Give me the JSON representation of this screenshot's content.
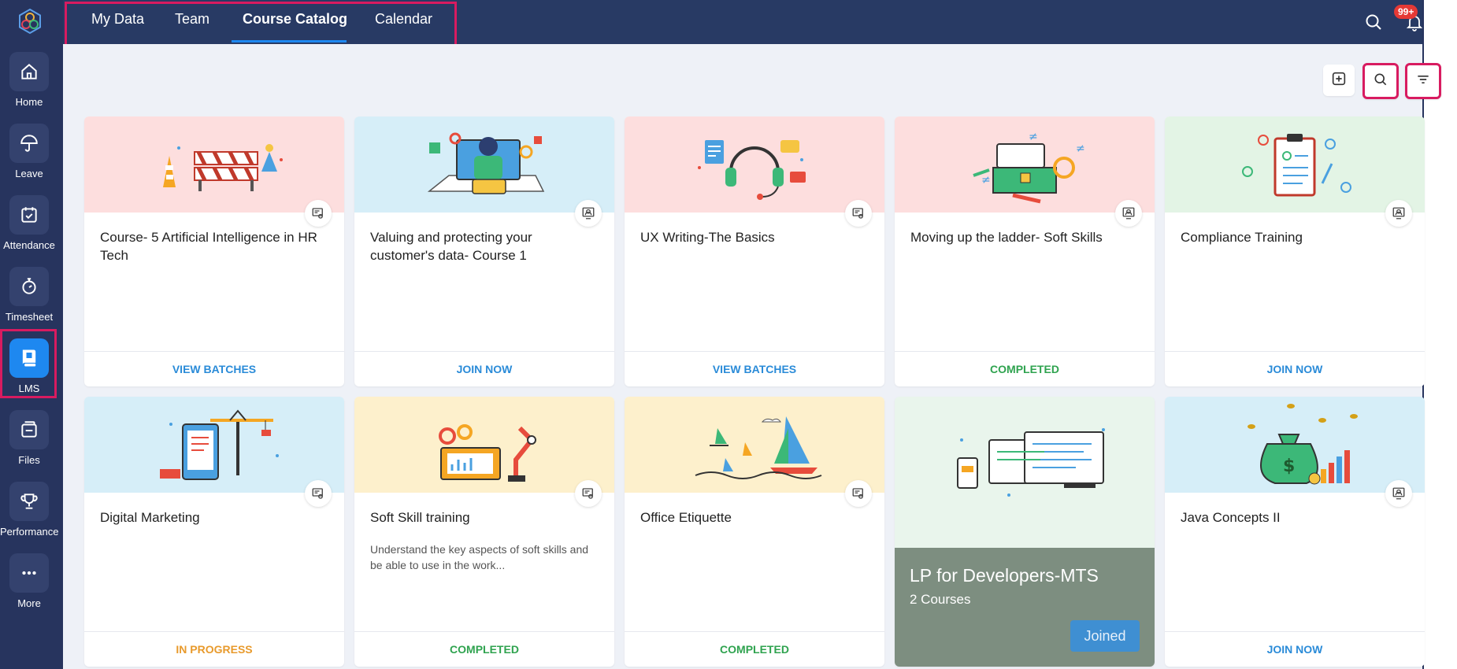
{
  "sidebar": {
    "items": [
      {
        "label": "Home",
        "icon": "home-icon"
      },
      {
        "label": "Leave",
        "icon": "umbrella-icon"
      },
      {
        "label": "Attendance",
        "icon": "calendar-check-icon"
      },
      {
        "label": "Timesheet",
        "icon": "stopwatch-icon"
      },
      {
        "label": "LMS",
        "icon": "book-icon",
        "active": true
      },
      {
        "label": "Files",
        "icon": "files-icon"
      },
      {
        "label": "Performance",
        "icon": "trophy-icon"
      },
      {
        "label": "More",
        "icon": "more-icon"
      }
    ]
  },
  "topnav": {
    "tabs": [
      {
        "label": "My Data"
      },
      {
        "label": "Team"
      },
      {
        "label": "Course Catalog",
        "active": true
      },
      {
        "label": "Calendar"
      }
    ],
    "notification_badge": "99+"
  },
  "toolbar": {
    "icons": [
      "add-icon",
      "search-icon",
      "filter-icon"
    ]
  },
  "courses": [
    {
      "title": "Course- 5 Artificial Intelligence in HR Tech",
      "action": "VIEW BATCHES",
      "banner": "construction-barrier",
      "bg": "#fddede",
      "type_icon": "classroom-icon"
    },
    {
      "title": "Valuing and protecting your customer's data- Course 1",
      "action": "JOIN NOW",
      "banner": "person-at-computer",
      "bg": "#d6eef8",
      "type_icon": "online-icon"
    },
    {
      "title": "UX Writing-The Basics",
      "action": "VIEW BATCHES",
      "banner": "headset-chat",
      "bg": "#fddede",
      "type_icon": "classroom-icon"
    },
    {
      "title": "Moving up the ladder- Soft Skills",
      "action": "COMPLETED",
      "banner": "toolbox",
      "bg": "#fddede",
      "type_icon": "online-icon"
    },
    {
      "title": "Compliance Training",
      "action": "JOIN NOW",
      "banner": "clipboard-checklist",
      "bg": "#e3f4e5",
      "type_icon": "online-icon"
    },
    {
      "title": "Digital Marketing",
      "action": "IN PROGRESS",
      "banner": "tablet-crane",
      "bg": "#d6eef8",
      "type_icon": "classroom-icon"
    },
    {
      "title": "Soft Skill training",
      "description": "Understand the key aspects of soft skills and be able to use in the work...",
      "action": "COMPLETED",
      "banner": "robot-arm-laptop",
      "bg": "#fdf0cc",
      "type_icon": "classroom-icon"
    },
    {
      "title": "Office Etiquette",
      "action": "COMPLETED",
      "banner": "sailboats",
      "bg": "#fdf0cc",
      "type_icon": "classroom-icon"
    },
    {
      "title": "Java Concepts II",
      "action": "JOIN NOW",
      "banner": "money-bag-chart",
      "bg": "#d6eef8",
      "type_icon": "online-icon"
    }
  ],
  "learning_path": {
    "title": "LP for Developers-MTS",
    "subtitle": "2 Courses",
    "button": "Joined"
  },
  "colors": {
    "sidebar_bg": "#27345e",
    "topnav_bg": "#283a64",
    "accent": "#1e88f0",
    "highlight": "#d81b60",
    "status_blue": "#2a8bd8",
    "status_green": "#2fa34f",
    "status_orange": "#e89a2c"
  }
}
